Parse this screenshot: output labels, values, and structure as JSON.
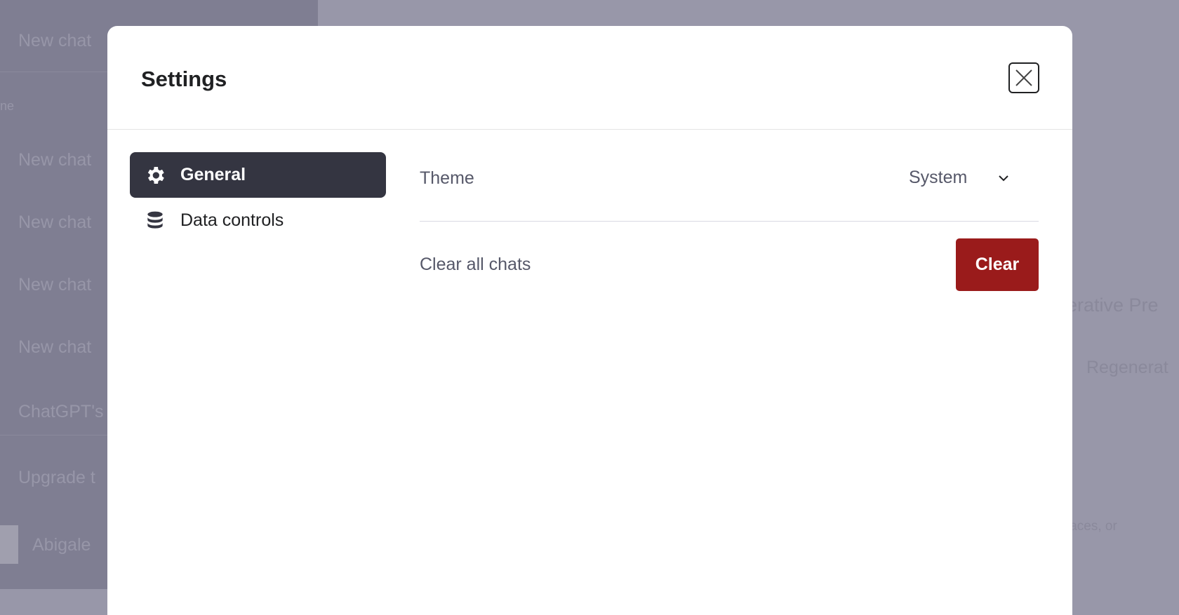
{
  "background": {
    "sidebar_items": [
      "New chat",
      "ne",
      "New chat",
      "New chat",
      "New chat",
      "New chat",
      "ChatGPT's",
      "Upgrade t",
      "Abigale"
    ],
    "main_fragments": [
      "erative Pre",
      "Regenerat",
      "laces, or"
    ]
  },
  "modal": {
    "title": "Settings",
    "close_icon": "x-icon",
    "nav": [
      {
        "label": "General",
        "icon": "gear-icon",
        "active": true
      },
      {
        "label": "Data controls",
        "icon": "database-icon",
        "active": false
      }
    ],
    "theme": {
      "label": "Theme",
      "value": "System"
    },
    "clear": {
      "label": "Clear all chats",
      "button": "Clear",
      "button_color": "#9a1b1b"
    }
  }
}
